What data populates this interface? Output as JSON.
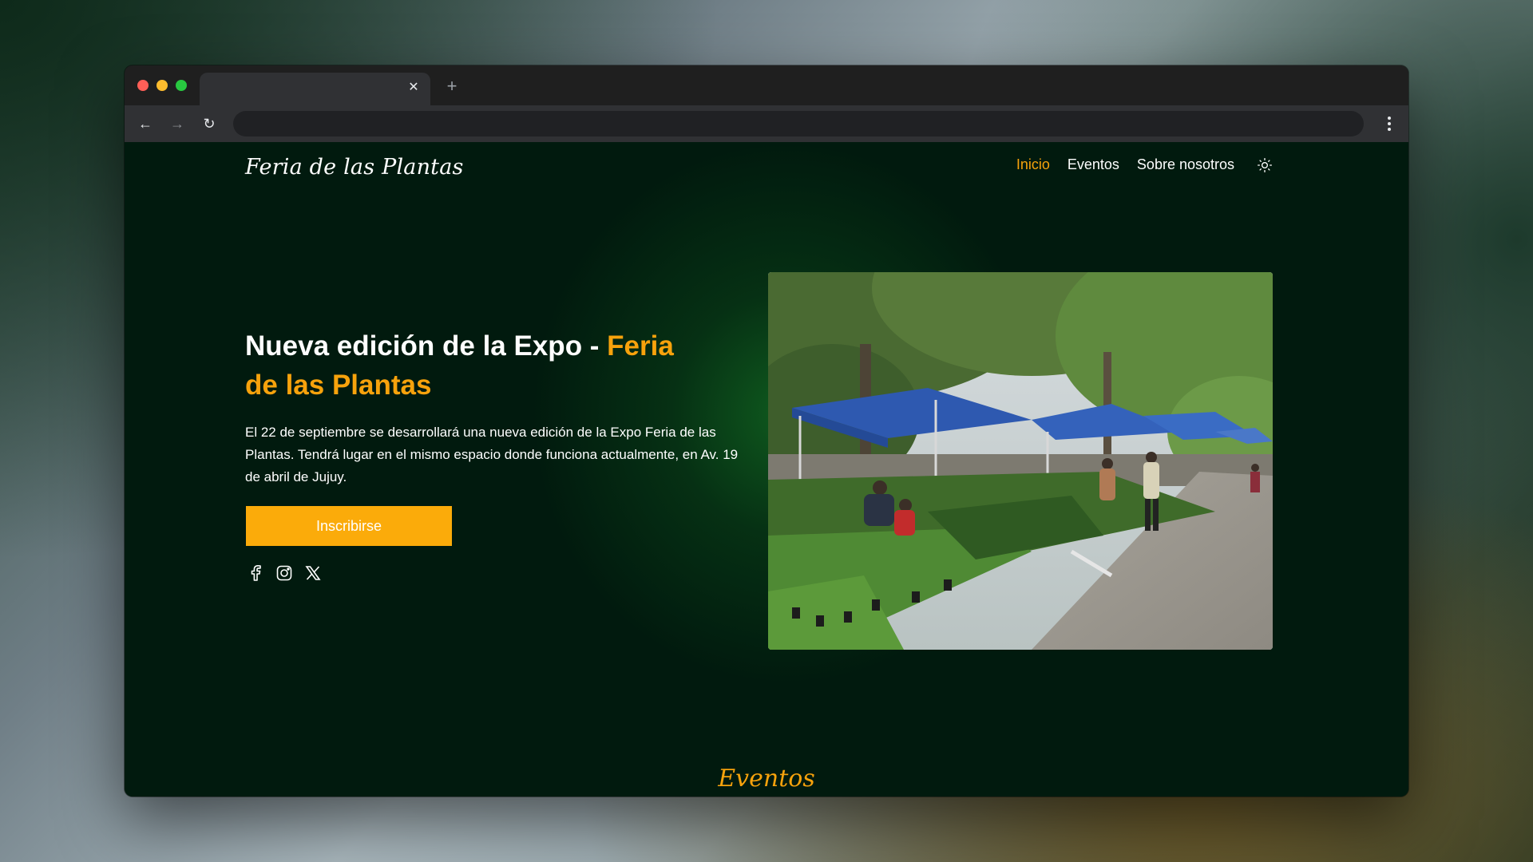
{
  "browser": {
    "tab_close_glyph": "✕",
    "new_tab_glyph": "+",
    "back_glyph": "←",
    "forward_glyph": "→",
    "reload_glyph": "↻"
  },
  "site": {
    "brand": "Feria de las Plantas",
    "nav": {
      "inicio": "Inicio",
      "eventos": "Eventos",
      "sobre": "Sobre nosotros"
    },
    "theme_toggle_icon": "sun-icon"
  },
  "hero": {
    "title_main": "Nueva edición de la Expo - ",
    "title_accent": "Feria de las Plantas",
    "description": "El 22 de septiembre se desarrollará una nueva edición de la Expo Feria de las Plantas. Tendrá lugar en el mismo espacio donde funciona actualmente, en Av. 19 de abril de Jujuy.",
    "cta_label": "Inscribirse",
    "social_icons": [
      "facebook-icon",
      "instagram-icon",
      "x-icon"
    ]
  },
  "events_section": {
    "title": "Eventos"
  },
  "colors": {
    "accent": "#f7a20c",
    "button": "#fbab0a",
    "page_bg": "#011a0e"
  }
}
